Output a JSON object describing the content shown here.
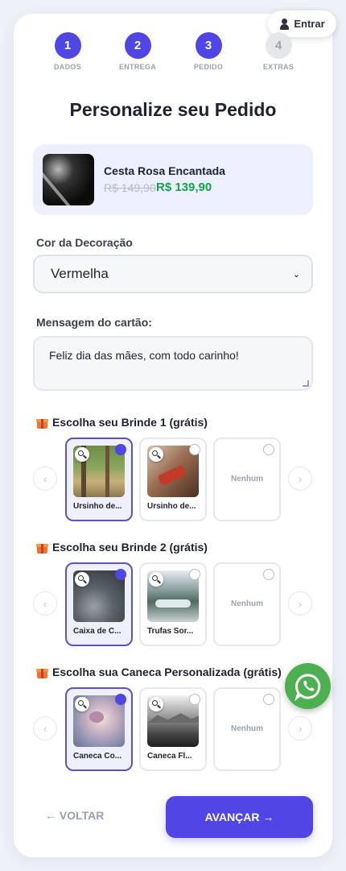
{
  "header": {
    "login_label": "Entrar"
  },
  "steps": [
    {
      "number": "1",
      "label": "DADOS",
      "active": true
    },
    {
      "number": "2",
      "label": "ENTREGA",
      "active": true
    },
    {
      "number": "3",
      "label": "PEDIDO",
      "active": true
    },
    {
      "number": "4",
      "label": "EXTRAS",
      "active": false
    }
  ],
  "title": "Personalize seu Pedido",
  "product": {
    "name": "Cesta Rosa Encantada",
    "old_price": "R$ 149,90",
    "new_price": "R$ 139,90"
  },
  "decoration": {
    "label": "Cor da Decoração",
    "selected": "Vermelha"
  },
  "message": {
    "label": "Mensagem do cartão:",
    "value": "Feliz dia das mães, com todo carinho!"
  },
  "gift1": {
    "heading": "Escolha seu Brinde 1 (grátis)",
    "options": [
      {
        "caption": "Ursinho de...",
        "selected": true
      },
      {
        "caption": "Ursinho de...",
        "selected": false
      },
      {
        "caption": "Nenhum",
        "selected": false
      }
    ]
  },
  "gift2": {
    "heading": "Escolha seu Brinde 2 (grátis)",
    "options": [
      {
        "caption": "Caixa de C...",
        "selected": true
      },
      {
        "caption": "Trufas Sor...",
        "selected": false
      },
      {
        "caption": "Nenhum",
        "selected": false
      }
    ]
  },
  "mug": {
    "heading": "Escolha sua Caneca Personalizada (grátis)",
    "options": [
      {
        "caption": "Caneca Co...",
        "selected": true
      },
      {
        "caption": "Caneca Fl...",
        "selected": false
      },
      {
        "caption": "Nenhum",
        "selected": false
      }
    ]
  },
  "nav": {
    "back_label": "← VOLTAR",
    "next_label": "AVANÇAR →"
  },
  "icons": {
    "prev": "‹",
    "next": "›",
    "select_chevron": "⌄"
  },
  "colors": {
    "primary": "#4f46e5",
    "price_green": "#16a34a",
    "whatsapp": "#4caf50"
  }
}
